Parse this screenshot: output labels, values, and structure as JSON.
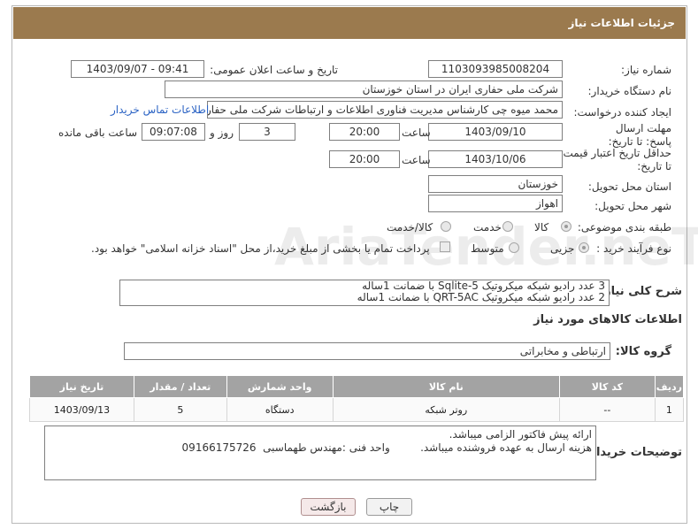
{
  "header": {
    "title": "جزئیات اطلاعات نیاز"
  },
  "fields": {
    "need_number_label": "شماره نیاز:",
    "need_number": "1103093985008204",
    "announce_label": "تاریخ و ساعت اعلان عمومی:",
    "announce_value": "1403/09/07 - 09:41",
    "buyer_label": "نام دستگاه خریدار:",
    "buyer_value": "شرکت ملی حفاری ایران در استان خوزستان",
    "creator_label": "ایجاد کننده درخواست:",
    "creator_value": "محمد میوه چی کارشناس مدیریت فناوری اطلاعات و ارتباطات  شرکت ملی حفاری",
    "contact_link": "اطلاعات تماس خریدار",
    "deadline_label": "مهلت ارسال پاسخ: تا تاریخ:",
    "deadline_date": "1403/09/10",
    "time_label": "ساعت",
    "deadline_time": "20:00",
    "deadline_days": "3",
    "days_label": "روز و",
    "remaining": "09:07:08",
    "remaining_label": "ساعت باقی مانده",
    "validity_label": "حداقل تاریخ اعتبار قیمت: تا تاریخ:",
    "validity_date": "1403/10/06",
    "validity_time": "20:00",
    "province_label": "استان محل تحویل:",
    "province_value": "خوزستان",
    "city_label": "شهر محل تحویل:",
    "city_value": "اهواز",
    "category_label": "طبقه بندی موضوعی:",
    "cat_goods": "کالا",
    "cat_service": "خدمت",
    "cat_goods_service": "کالا/خدمت",
    "process_label": "نوع فرآیند خرید :",
    "proc_minor": "جزیی",
    "proc_medium": "متوسط",
    "proc_note": "پرداخت تمام یا بخشی از مبلغ خرید،از محل \"اسناد خزانه اسلامی\" خواهد بود.",
    "summary_label": "شرح کلی نیاز:",
    "summary_line1": "3 عدد رادیو شبکه میکروتیک Sqlite-5  با ضمانت 1ساله",
    "summary_line2": "2 عدد رادیو شبکه میکروتیک QRT-5AC با ضمانت 1ساله"
  },
  "goods_section": {
    "title": "اطلاعات کالاهای مورد نیاز",
    "group_label": "گروه کالا:",
    "group_value": "ارتباطی و مخابراتی"
  },
  "table": {
    "headers": [
      "ردیف",
      "کد کالا",
      "نام کالا",
      "واحد شمارش",
      "تعداد / مقدار",
      "تاریخ نیاز"
    ],
    "rows": [
      [
        "1",
        "--",
        "روتر شبکه",
        "دستگاه",
        "5",
        "1403/09/13"
      ]
    ]
  },
  "buyer_notes": {
    "label": "توضیحات خریدار:",
    "line1": "ارائه پیش فاکتور الزامی میباشد.",
    "line2": "هزینه ارسال به عهده فروشنده میباشد.         واحد فنی :مهندس طهماسبی  09166175726"
  },
  "buttons": {
    "print": "چاپ",
    "back": "بازگشت"
  },
  "watermark": "AriaTender.neT"
}
